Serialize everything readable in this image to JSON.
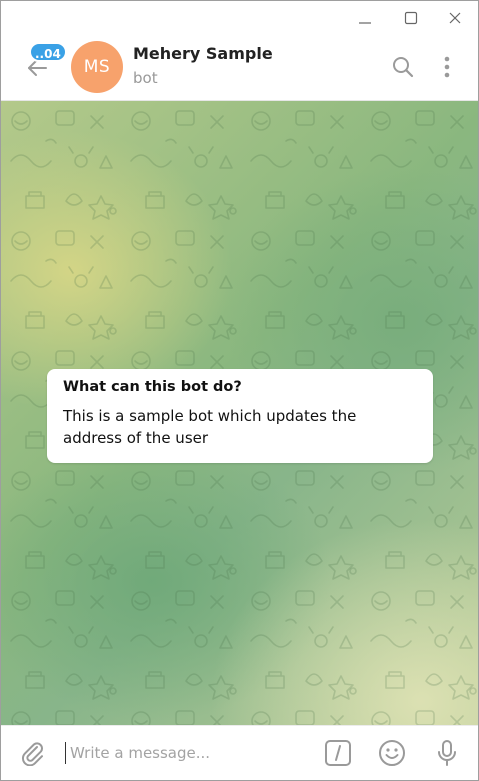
{
  "window": {
    "controls": [
      "minimize",
      "maximize",
      "close"
    ]
  },
  "header": {
    "unread_badge": "..04",
    "avatar_initials": "MS",
    "avatar_color": "#f7a26c",
    "title": "Mehery Sample",
    "subtitle": "bot"
  },
  "bot_info": {
    "title": "What can this bot do?",
    "description": "This is a sample bot which updates the address of the user"
  },
  "composer": {
    "placeholder": "Write a message..."
  },
  "icons": {
    "back": "arrow-left-icon",
    "search": "search-icon",
    "menu": "more-vertical-icon",
    "attach": "paperclip-icon",
    "commands": "slash-command-icon",
    "emoji": "smile-icon",
    "voice": "microphone-icon"
  },
  "colors": {
    "accent": "#3aa1e6",
    "icon_gray": "#9a9a9a"
  }
}
